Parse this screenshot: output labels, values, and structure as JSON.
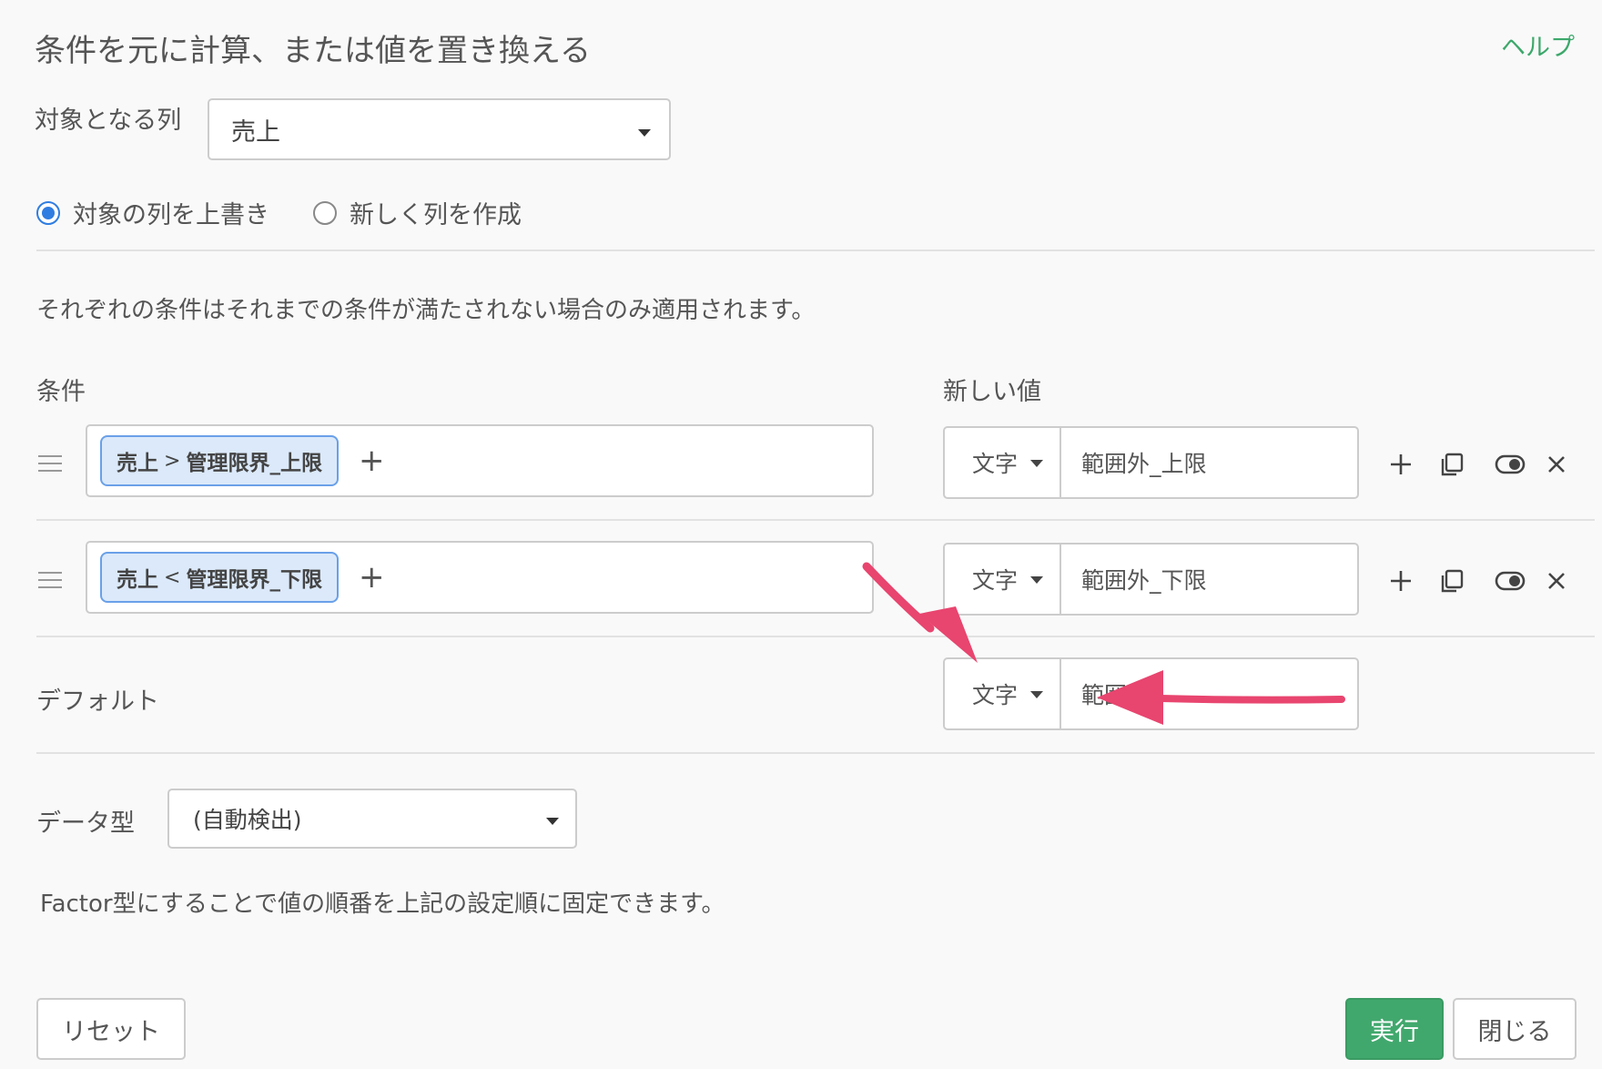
{
  "header": {
    "title": "条件を元に計算、または値を置き換える",
    "help_label": "ヘルプ"
  },
  "target_column": {
    "label": "対象となる列",
    "value": "売上"
  },
  "mode": {
    "options": [
      {
        "label": "対象の列を上書き",
        "selected": true
      },
      {
        "label": "新しく列を作成",
        "selected": false
      }
    ]
  },
  "description": "それぞれの条件はそれまでの条件が満たされない場合のみ適用されます。",
  "columns": {
    "condition_header": "条件",
    "value_header": "新しい値"
  },
  "conditions": [
    {
      "chip_left": "売上",
      "chip_op": ">",
      "chip_right": "管理限界_上限",
      "add_label": "+",
      "value_type": "文字",
      "value": "範囲外_上限"
    },
    {
      "chip_left": "売上",
      "chip_op": "<",
      "chip_right": "管理限界_下限",
      "add_label": "+",
      "value_type": "文字",
      "value": "範囲外_下限"
    }
  ],
  "default_row": {
    "label": "デフォルト",
    "value_type": "文字",
    "value": "範囲内"
  },
  "data_type": {
    "label": "データ型",
    "value": "(自動検出)"
  },
  "factor_note": "Factor型にすることで値の順番を上記の設定順に固定できます。",
  "footer": {
    "reset_label": "リセット",
    "run_label": "実行",
    "close_label": "閉じる"
  },
  "colors": {
    "accent_green": "#41a86d",
    "help_green": "#3da86b",
    "chip_bg": "#dbe9fa",
    "chip_border": "#6aa0e8",
    "radio_blue": "#2f7de1",
    "annotation_arrow": "#e8456f"
  },
  "icons": {
    "drag_handle": "hamburger-icon",
    "add_row": "plus-icon",
    "duplicate": "copy-icon",
    "toggle": "toggle-icon",
    "remove": "close-icon"
  }
}
